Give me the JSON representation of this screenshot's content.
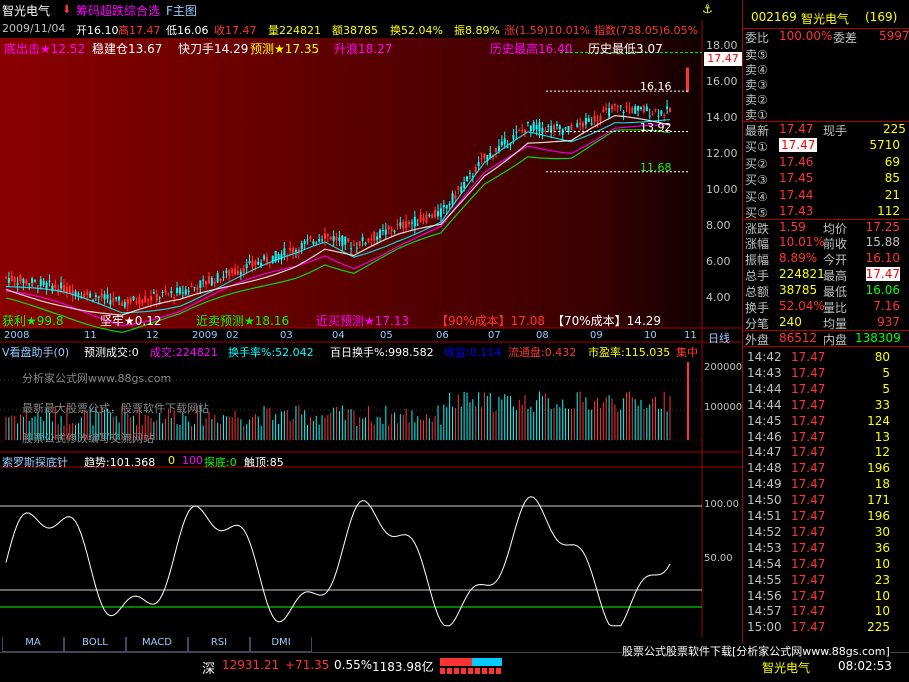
{
  "header": {
    "name": "智光电气",
    "indicator": "筹码超跌综合选",
    "tab_main": "F主图"
  },
  "info": {
    "date": "2009/11/04",
    "open": "开16.10",
    "high": "高17.47",
    "low": "低16.06",
    "close": "收17.47",
    "vol": "量224821",
    "amt": "额38785",
    "turnover": "换52.04%",
    "amp": "振8.89%",
    "chg": "涨(1.59)10.01%",
    "idx": "指数(738.05)6.05%"
  },
  "main_labels": {
    "bottom_fish": "底出击★12.52",
    "steady": "稳建仓13.67",
    "fast": "快刀手14.29",
    "predict": "预测★17.35",
    "rise": "升浪18.27",
    "hist_high": "历史最高16.40",
    "hist_low": "历史最低3.07",
    "profit": "获利★99.8",
    "firm": "坚牢★0.12",
    "near_sell": "近卖预测★18.16",
    "near_buy": "近买预测★17.13",
    "cost90": "【90%成本】17.08",
    "cost70": "【70%成本】14.29",
    "lvl_1616": "16.16",
    "lvl_1392": "13.92",
    "lvl_1168": "11.68",
    "price_tag": "17.47"
  },
  "price_axis": [
    "18.00",
    "16.00",
    "14.00",
    "12.00",
    "10.00",
    "8.00",
    "6.00",
    "4.00"
  ],
  "time_axis": [
    "2008",
    "11",
    "12",
    "2009",
    "02",
    "03",
    "04",
    "05",
    "06",
    "07",
    "08",
    "09",
    "10",
    "11"
  ],
  "time_axis_right": "日线",
  "vol_panel": {
    "title": "V看盘助手(0)",
    "pred": "预测成交:0",
    "vol": "成交:224821",
    "turn": "换手率%:52.042",
    "hundred": "百日换手%:998.582",
    "yield": "收益:0.114",
    "circ": "流通盘:0.432",
    "pe": "市盈率:115.035",
    "fairy": "集中",
    "ad1": "分析家公式网www.88gs.com",
    "ad2": "最新最大股票公式，股票软件下载网站",
    "ad3": "股票公式修改编写交流网站",
    "axis": [
      "200000",
      "100000"
    ]
  },
  "osc_panel": {
    "title": "索罗斯探底针",
    "trend": "趋势:101.368",
    "v0": "0",
    "v100": "100",
    "probe": "探底:0",
    "touch": "触顶:85",
    "axis": [
      "100.00",
      "50.00"
    ]
  },
  "tabs": [
    "MA",
    "BOLL",
    "MACD",
    "RSI",
    "DMI"
  ],
  "quote": {
    "code": "002169",
    "name": "智光电气",
    "num": "(169)",
    "weibi_l": "委比",
    "weibi_v": "100.00%",
    "weicha_l": "委差",
    "weicha_v": "5997",
    "sells": [
      "卖⑤",
      "卖④",
      "卖③",
      "卖②",
      "卖①"
    ],
    "last_l": "最新",
    "last_v": "17.47",
    "cur_l": "现手",
    "cur_v": "225",
    "buys": [
      {
        "l": "买①",
        "p": "17.47",
        "v": "5710"
      },
      {
        "l": "买②",
        "p": "17.46",
        "v": "69"
      },
      {
        "l": "买③",
        "p": "17.45",
        "v": "85"
      },
      {
        "l": "买④",
        "p": "17.44",
        "v": "21"
      },
      {
        "l": "买⑤",
        "p": "17.43",
        "v": "112"
      }
    ],
    "stats": [
      {
        "a": "涨跌",
        "av": "1.59",
        "b": "均价",
        "bv": "17.25"
      },
      {
        "a": "涨幅",
        "av": "10.01%",
        "b": "前收",
        "bv": "15.88"
      },
      {
        "a": "振幅",
        "av": "8.89%",
        "b": "今开",
        "bv": "16.10"
      },
      {
        "a": "总手",
        "av": "224821",
        "b": "最高",
        "bv": "17.47"
      },
      {
        "a": "总额",
        "av": "38785",
        "b": "最低",
        "bv": "16.06"
      },
      {
        "a": "换手",
        "av": "52.04%",
        "b": "量比",
        "bv": "7.16"
      },
      {
        "a": "分笔",
        "av": "240",
        "b": "均量",
        "bv": "937"
      }
    ],
    "outer_l": "外盘",
    "outer_v": "86512",
    "inner_l": "内盘",
    "inner_v": "138309"
  },
  "ticks": [
    {
      "t": "14:42",
      "p": "17.47",
      "v": "80"
    },
    {
      "t": "14:43",
      "p": "17.47",
      "v": "5"
    },
    {
      "t": "14:44",
      "p": "17.47",
      "v": "5"
    },
    {
      "t": "14:44",
      "p": "17.47",
      "v": "33"
    },
    {
      "t": "14:45",
      "p": "17.47",
      "v": "124"
    },
    {
      "t": "14:46",
      "p": "17.47",
      "v": "13"
    },
    {
      "t": "14:47",
      "p": "17.47",
      "v": "12"
    },
    {
      "t": "14:48",
      "p": "17.47",
      "v": "196"
    },
    {
      "t": "14:49",
      "p": "17.47",
      "v": "18"
    },
    {
      "t": "14:50",
      "p": "17.47",
      "v": "171"
    },
    {
      "t": "14:51",
      "p": "17.47",
      "v": "196"
    },
    {
      "t": "14:52",
      "p": "17.47",
      "v": "30"
    },
    {
      "t": "14:53",
      "p": "17.47",
      "v": "36"
    },
    {
      "t": "14:54",
      "p": "17.47",
      "v": "10"
    },
    {
      "t": "14:55",
      "p": "17.47",
      "v": "23"
    },
    {
      "t": "14:56",
      "p": "17.47",
      "v": "10"
    },
    {
      "t": "14:57",
      "p": "17.47",
      "v": "10"
    },
    {
      "t": "15:00",
      "p": "17.47",
      "v": "225"
    }
  ],
  "status": {
    "mkt": "深",
    "idx": "12931.21",
    "chg": "+71.35",
    "pct": "0.55%",
    "amt": "1183.98亿",
    "ad": "股票公式股票软件下载[分析家公式网www.88gs.com]",
    "stock": "智光电气",
    "time": "08:02:53"
  },
  "chart_data": {
    "type": "candlestick",
    "ylim": [
      3,
      19
    ],
    "ylabel": "",
    "xlabel": "",
    "annotations": [
      "16.16",
      "13.92",
      "11.68"
    ],
    "last_close": 17.47
  }
}
